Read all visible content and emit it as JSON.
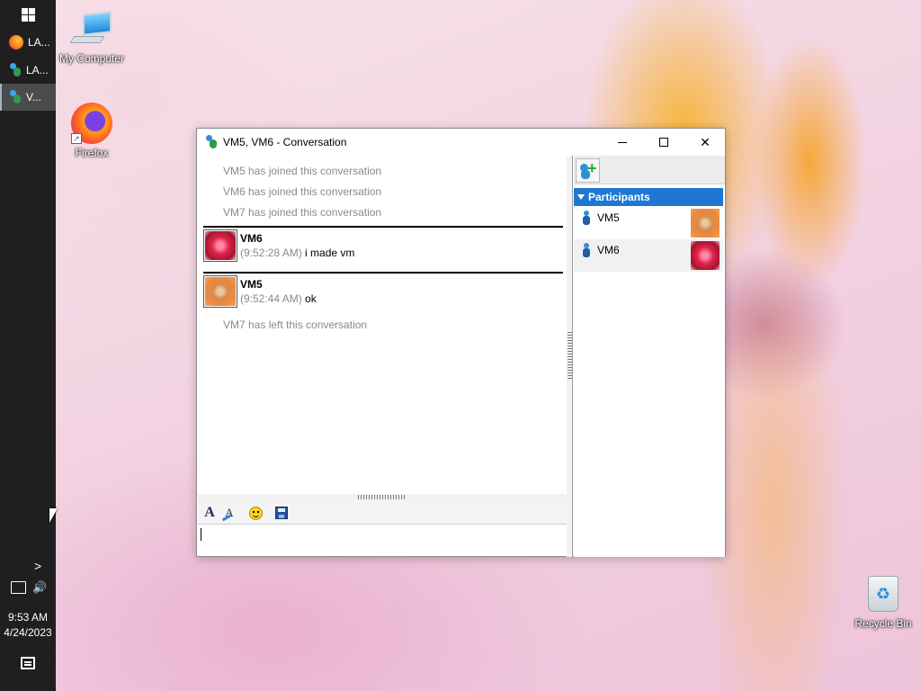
{
  "taskbar": {
    "items": [
      {
        "label": "LA...",
        "icon": "firefox-icon"
      },
      {
        "label": "LA...",
        "icon": "messenger-icon"
      },
      {
        "label": "V...",
        "icon": "messenger-icon"
      }
    ],
    "chevron": ">",
    "volume_icon": "🔊",
    "clock_time": "9:53 AM",
    "clock_date": "4/24/2023"
  },
  "desktop": {
    "icons": [
      {
        "label": "My Computer"
      },
      {
        "label": "Firefox"
      },
      {
        "label": "Recycle Bin"
      }
    ]
  },
  "window": {
    "title": "VM5, VM6 - Conversation",
    "close_glyph": "✕"
  },
  "chat": {
    "system_messages": [
      "VM5 has joined this conversation",
      "VM6 has joined this conversation",
      "VM7 has joined this conversation",
      "VM7 has left this conversation"
    ],
    "messages": [
      {
        "sender": "VM6",
        "time": "(9:52:28 AM)",
        "text": "i made vm"
      },
      {
        "sender": "VM5",
        "time": "(9:52:44 AM)",
        "text": "ok"
      }
    ],
    "input_value": ""
  },
  "format_toolbar": {
    "font_glyph": "A",
    "color_glyph": "A"
  },
  "participants": {
    "header": "Participants",
    "add_glyph": "+",
    "list": [
      {
        "name": "VM5"
      },
      {
        "name": "VM6"
      }
    ]
  },
  "colors": {
    "accent": "#1e78d2",
    "system_text": "#8a8a8a"
  }
}
